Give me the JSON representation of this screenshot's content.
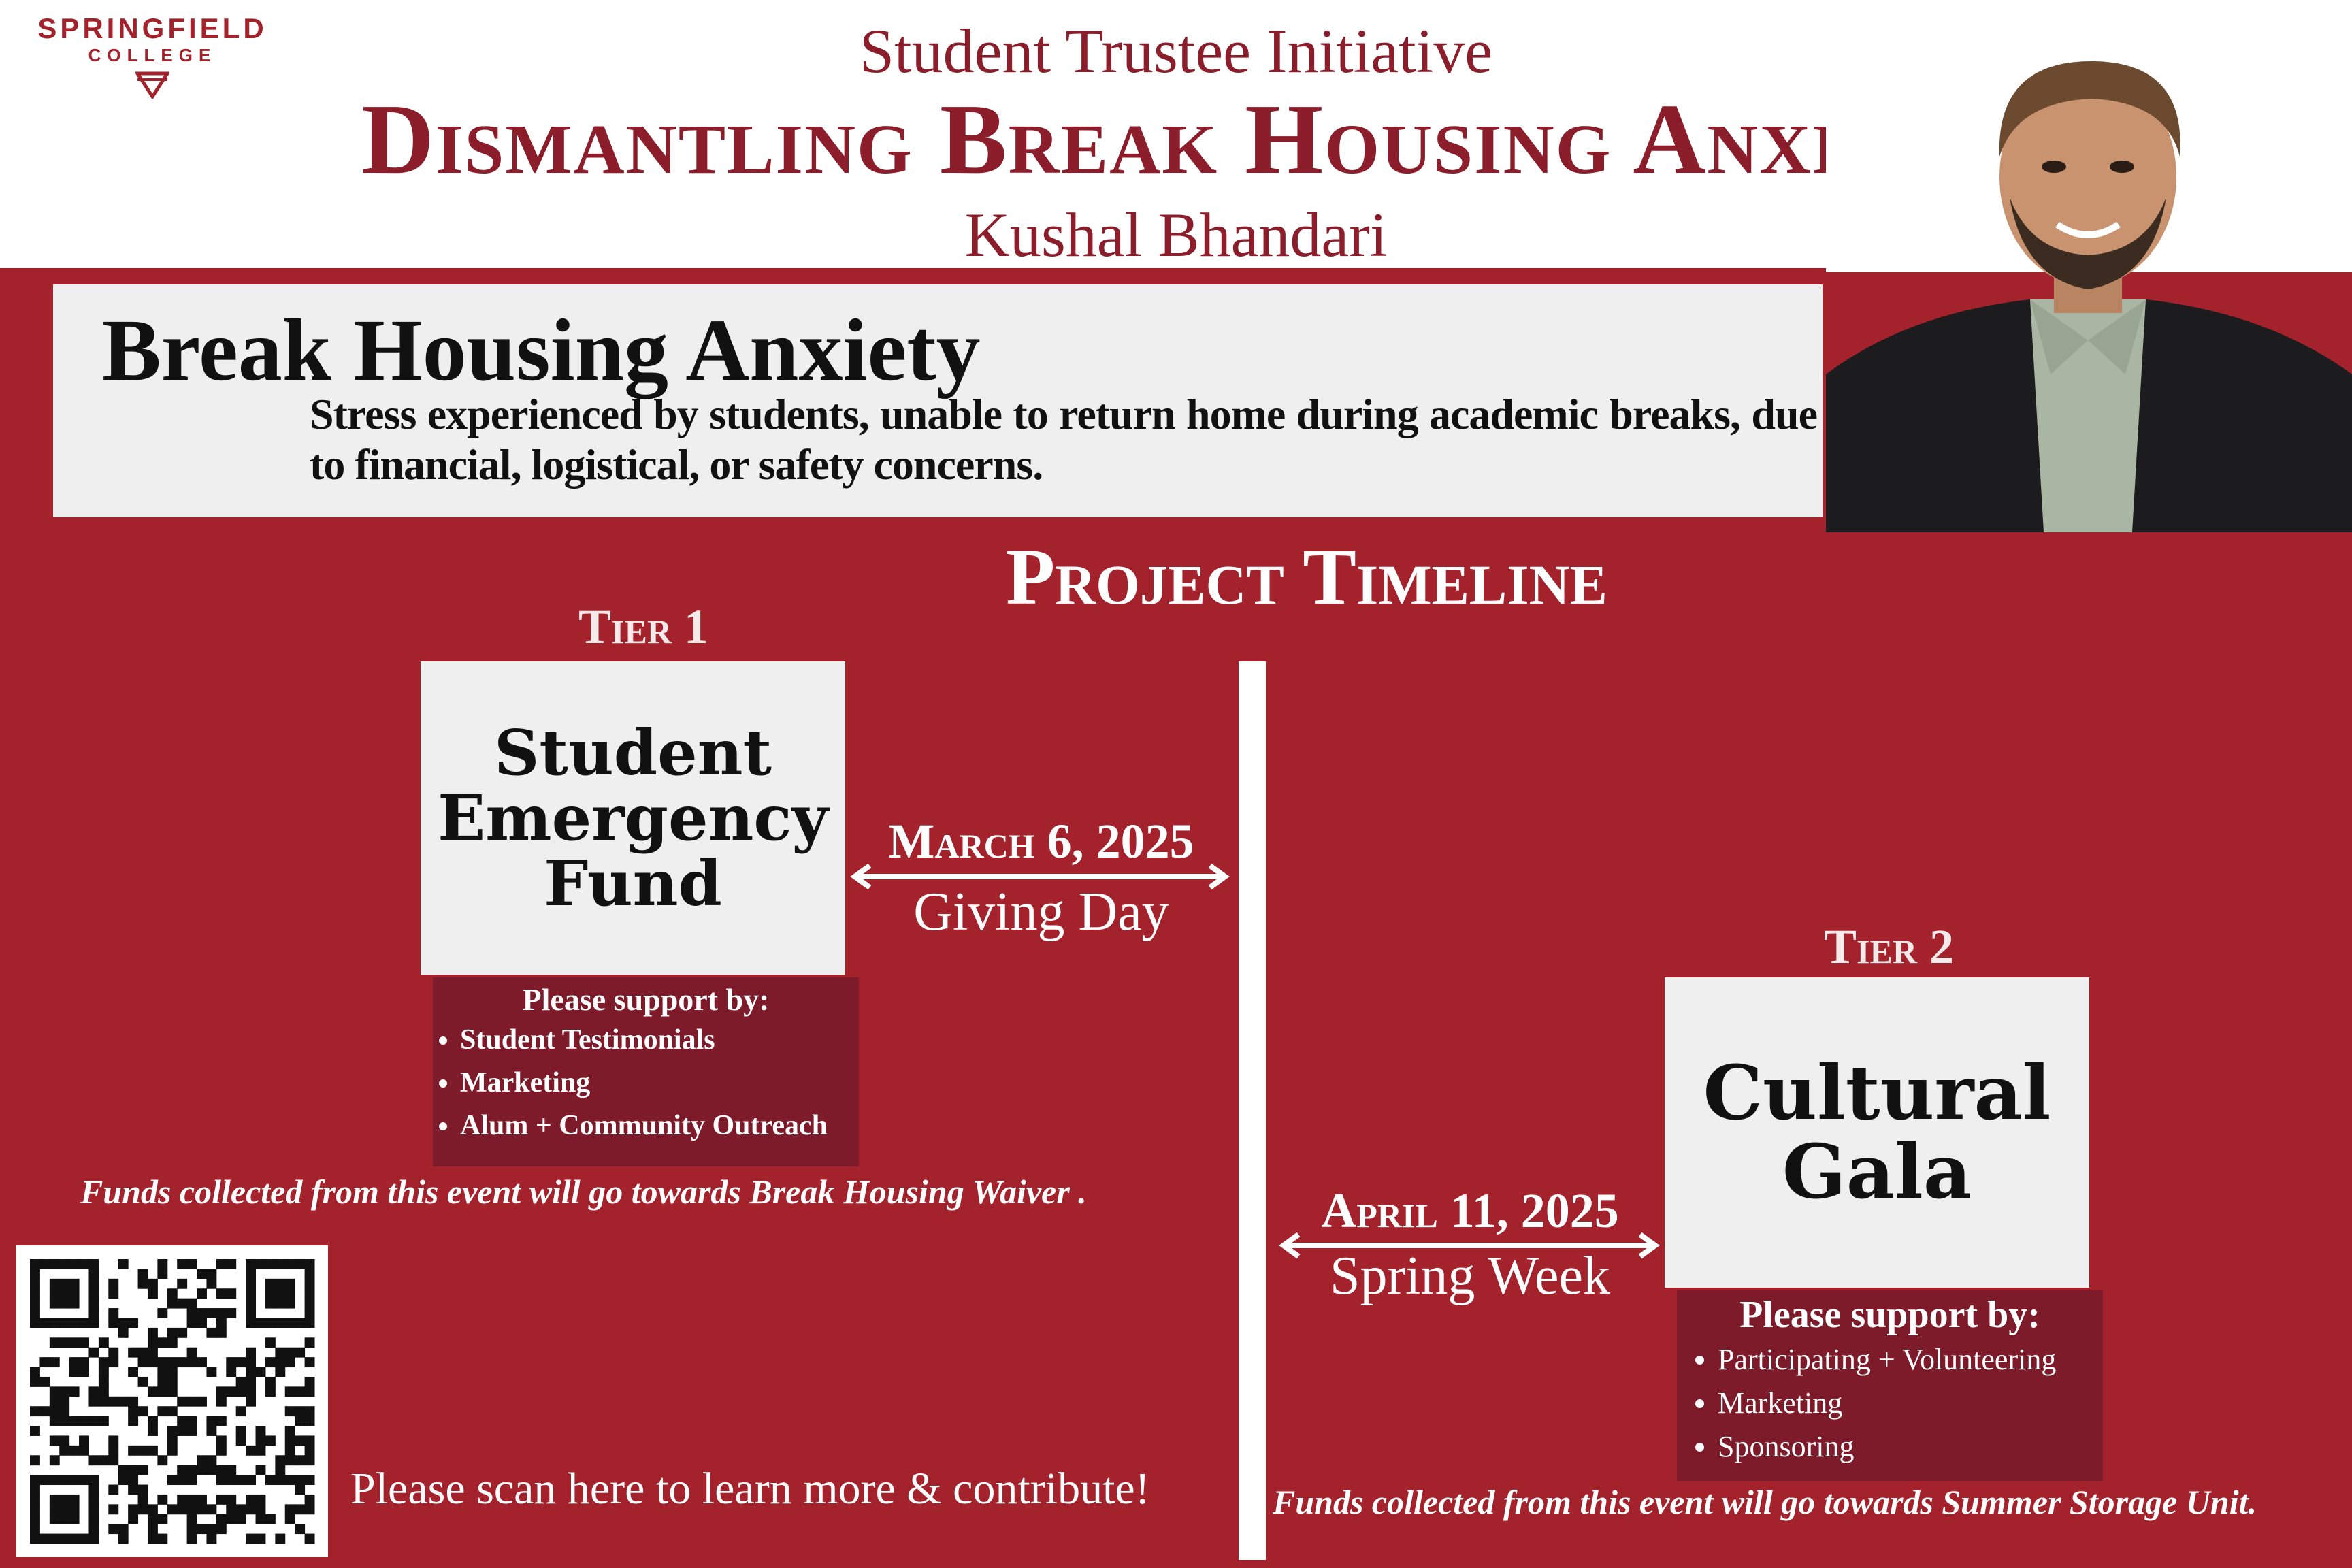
{
  "logo": {
    "line1": "SPRINGFIELD",
    "line2": "COLLEGE"
  },
  "header": {
    "subtitle": "Student Trustee Initiative",
    "title": "Dismantling Break Housing Anxiety",
    "author": "Kushal Bhandari"
  },
  "definition": {
    "title": "Break Housing Anxiety",
    "text": "Stress experienced by students, unable to return home during academic breaks, due to financial, logistical, or safety concerns."
  },
  "timeline": {
    "title": "Project Timeline",
    "tier1": {
      "label": "Tier 1",
      "event_lines": [
        "Student",
        "Emergency",
        "Fund"
      ],
      "date": "March 6, 2025",
      "day": "Giving Day",
      "support_head": "Please support by:",
      "support_items": [
        "Student Testimonials",
        "Marketing",
        "Alum + Community Outreach"
      ],
      "funds": "Funds collected from this event will go towards Break Housing Waiver ."
    },
    "tier2": {
      "label": "Tier 2",
      "event_lines": [
        "Cultural",
        "Gala"
      ],
      "date": "April 11, 2025",
      "day": "Spring Week",
      "support_head": "Please support by:",
      "support_items": [
        "Participating + Volunteering",
        "Marketing",
        "Sponsoring"
      ],
      "funds": "Funds collected from this event will go towards Summer Storage Unit."
    }
  },
  "qr": {
    "caption": "Please scan here to learn more & contribute!"
  },
  "colors": {
    "brand_red": "#a3222b",
    "dark_red": "#7d1b2a",
    "title_red": "#8c1d2a",
    "box_gray": "#efefef"
  }
}
